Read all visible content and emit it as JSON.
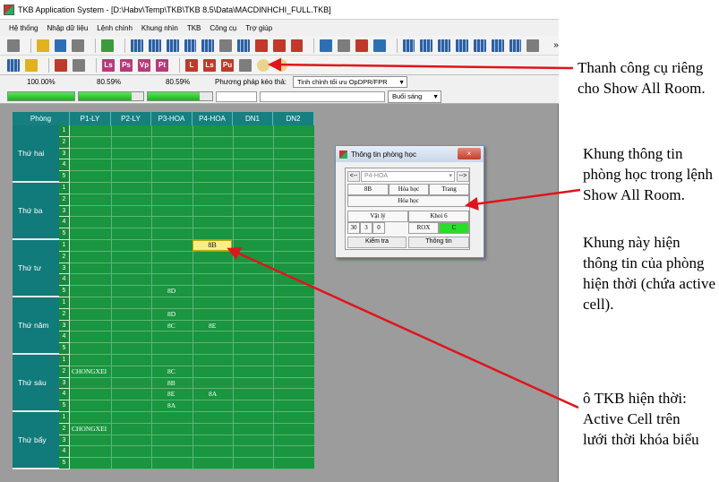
{
  "window": {
    "title": "TKB Application System - [D:\\Habv\\Temp\\TKB\\TKB 8.5\\Data\\MACDINHCHI_FULL.TKB]"
  },
  "menu": [
    "Hệ thống",
    "Nhập dữ liệu",
    "Lệnh chính",
    "Khung nhìn",
    "TKB",
    "Công cụ",
    "Trợ giúp"
  ],
  "toolbar": {
    "overflow_glyph": "»",
    "icon_glyphs": [
      "Ls",
      "Ps",
      "Vp",
      "Pt",
      "L",
      "Ls",
      "Pu"
    ]
  },
  "status": {
    "percents": [
      "100.00%",
      "80.59%",
      "80.59%"
    ],
    "progress_fractions": [
      1.0,
      0.82,
      0.8
    ],
    "method_label": "Phương pháp kéo thả:",
    "method_value": "Tinh chỉnh tối ưu OpDPR/FPR",
    "session_value": "Buổi sáng"
  },
  "grid": {
    "room_header": "Phòng",
    "columns": [
      "P1-LY",
      "P2-LY",
      "P3-HOA",
      "P4-HOA",
      "DN1",
      "DN2"
    ],
    "days": [
      "Thứ hai",
      "Thứ ba",
      "Thứ tư",
      "Thứ năm",
      "Thứ sáu",
      "Thứ bẩy"
    ],
    "periods": [
      "1",
      "2",
      "3",
      "4",
      "5"
    ],
    "entries": [
      {
        "day": 2,
        "period": 0,
        "col": 3,
        "text": "8B",
        "active": true
      },
      {
        "day": 2,
        "period": 4,
        "col": 2,
        "text": "8D"
      },
      {
        "day": 3,
        "period": 1,
        "col": 2,
        "text": "8D"
      },
      {
        "day": 3,
        "period": 2,
        "col": 2,
        "text": "8C"
      },
      {
        "day": 3,
        "period": 2,
        "col": 3,
        "text": "8E"
      },
      {
        "day": 4,
        "period": 1,
        "col": 0,
        "text": "CHONGXEI"
      },
      {
        "day": 4,
        "period": 1,
        "col": 2,
        "text": "8C"
      },
      {
        "day": 4,
        "period": 2,
        "col": 2,
        "text": "8B"
      },
      {
        "day": 4,
        "period": 3,
        "col": 2,
        "text": "8E"
      },
      {
        "day": 4,
        "period": 3,
        "col": 3,
        "text": "8A"
      },
      {
        "day": 4,
        "period": 4,
        "col": 2,
        "text": "8A"
      },
      {
        "day": 5,
        "period": 1,
        "col": 0,
        "text": "CHONGXEI"
      }
    ]
  },
  "dialog": {
    "title": "Thông tin phòng học",
    "close_glyph": "×",
    "prev": "<--",
    "next": "-->",
    "room_select": "P4-HOA",
    "class": "8B",
    "subject": "Hóa học",
    "page": "Trang",
    "subject2": "Hóa học",
    "subject_group": "Vật lý",
    "grade": "Khoi 6",
    "n1": "30",
    "n2": "3",
    "n3": "0",
    "code": "ROX",
    "flag": "C",
    "check_button": "Kiểm tra",
    "info_button": "Thông tin"
  },
  "annotations": {
    "toolbar_note": "Thanh công cụ riêng cho Show All Room.",
    "dialog_note_1": "Khung thông tin phòng học trong lệnh Show All Room.",
    "dialog_note_2": "Khung này hiện thông tin của phòng hiện thời (chứa active cell).",
    "cell_note": "ô TKB hiện thời: Active Cell trên lưới thời khóa biểu"
  },
  "colors": {
    "grid_green": "#19963f",
    "header_teal": "#168080",
    "active_cell": "#f7ee8a",
    "arrow_red": "#e0141c"
  }
}
